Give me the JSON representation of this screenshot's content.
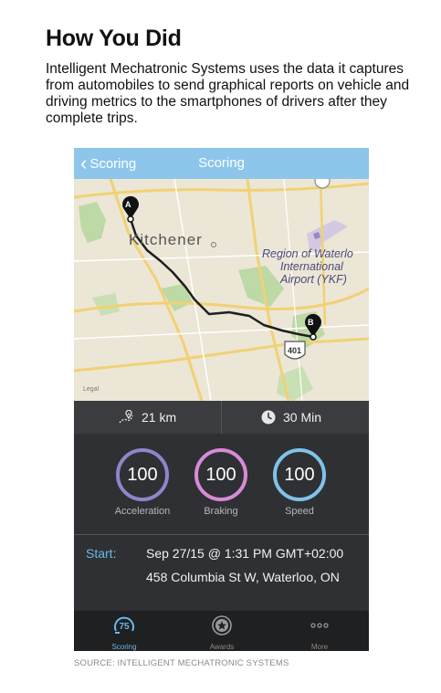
{
  "article": {
    "headline": "How You Did",
    "subtitle": "Intelligent Mechatronic Systems uses the data it captures from automobiles to send graphical reports on vehicle and driving metrics to the smartphones of drivers after they complete trips.",
    "source": "SOURCE: INTELLIGENT MECHATRONIC SYSTEMS"
  },
  "app": {
    "nav": {
      "back_label": "Scoring",
      "title": "Scoring"
    },
    "map": {
      "city_label": "Kitchener",
      "airport_label_line1": "Region of Waterlo",
      "airport_label_line2": "International",
      "airport_label_line3": "Airport (YKF)",
      "highway_label": "401",
      "legal_label": "Legal",
      "marker_a": "A",
      "marker_b": "B"
    },
    "stats": {
      "distance": "21 km",
      "duration": "30 Min"
    },
    "scores": [
      {
        "value": "100",
        "label": "Acceleration",
        "color": "#8d86c9"
      },
      {
        "value": "100",
        "label": "Braking",
        "color": "#d88ad8"
      },
      {
        "value": "100",
        "label": "Speed",
        "color": "#7fc3ea"
      }
    ],
    "trip": {
      "start_label": "Start:",
      "datetime": "Sep 27/15 @ 1:31 PM GMT+02:00",
      "address": "458 Columbia St W, Waterloo, ON"
    },
    "tabs": [
      {
        "label": "Scoring",
        "badge": "75",
        "icon": "score-gauge-icon",
        "active": true
      },
      {
        "label": "Awards",
        "icon": "award-star-icon",
        "active": false
      },
      {
        "label": "More",
        "icon": "more-dots-icon",
        "active": false
      }
    ],
    "colors": {
      "nav_bg": "#8dc6ea",
      "panel_bg": "#2f3033",
      "accent": "#69b8ea"
    }
  }
}
